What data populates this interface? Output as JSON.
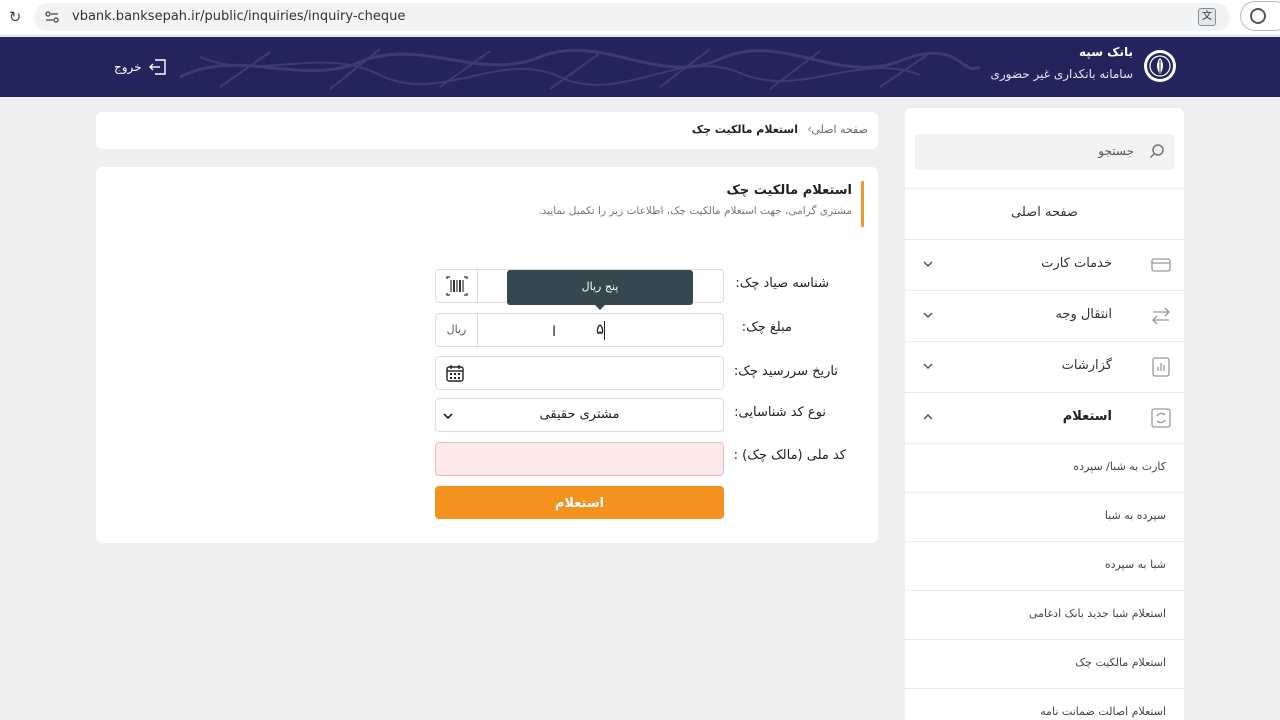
{
  "browser": {
    "url": "vbank.banksepah.ir/public/inquiries/inquiry-cheque"
  },
  "header": {
    "bank_name": "بانک سپه",
    "system_name": "سامانه بانکداری غیر حضوری",
    "logout_label": "خروج",
    "bg_color": "#24245c"
  },
  "sidebar": {
    "search_placeholder": "جستجو",
    "home_label": "صفحه اصلی",
    "menu": [
      {
        "label": "خدمات کارت",
        "icon": "card-icon"
      },
      {
        "label": "انتقال وجه",
        "icon": "transfer-icon"
      },
      {
        "label": "گزارشات",
        "icon": "report-icon"
      },
      {
        "label": "استعلام",
        "icon": "inquiry-icon"
      }
    ],
    "submenu": [
      "کارت به شبا/ سپرده",
      "سپرده به شبا",
      "شبا به سپرده",
      "استعلام شبا جدید بانک ادغامی",
      "استعلام مالکیت چک",
      "استعلام اصالت ضمانت نامه"
    ]
  },
  "breadcrumb": {
    "home": "صفحه اصلی",
    "current": "استعلام مالکیت چک"
  },
  "form": {
    "title": "استعلام مالکیت چک",
    "subtitle": "مشتری گرامی، جهت استعلام مالکیت چک، اطلاعات زیر را تکمیل نمایید.",
    "sayad_label": "شناسه صیاد چک:",
    "amount_label": "مبلغ چک:",
    "amount_value": "۵",
    "amount_unit": "ریال",
    "amount_tooltip": "پنج ریال",
    "due_date_label": "تاریخ سررسید چک:",
    "id_type_label": "نوع کد شناسایی:",
    "id_type_value": "مشتری حقیقی",
    "national_code_label": "کد ملی (مالک چک) :",
    "submit_label": "استعلام",
    "accent_color": "#f4921f",
    "error_bg": "#fde8ea"
  }
}
